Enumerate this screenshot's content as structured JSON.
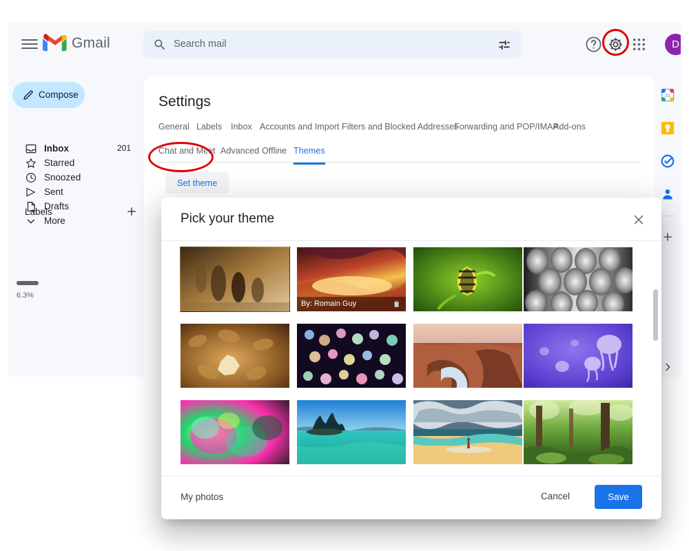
{
  "app": {
    "name": "Gmail",
    "logo_icon": "gmail-logo-icon",
    "menu_icon": "hamburger-menu-icon"
  },
  "search": {
    "placeholder": "Search mail",
    "value": "",
    "search_icon": "search-icon",
    "filter_icon": "search-options-filter-icon"
  },
  "topbar_icons": {
    "help": "help-circle-icon",
    "settings": "gear-icon",
    "apps": "google-apps-grid-icon",
    "avatar_letter": "D",
    "avatar_color": "#8e24aa"
  },
  "sidebar": {
    "compose_label": "Compose",
    "compose_icon": "pencil-icon",
    "compose_bg": "#c2e7ff",
    "items": [
      {
        "label": "Inbox",
        "icon": "inbox-icon",
        "count": "201",
        "active": true
      },
      {
        "label": "Starred",
        "icon": "star-icon",
        "count": "",
        "active": false
      },
      {
        "label": "Snoozed",
        "icon": "clock-icon",
        "count": "",
        "active": false
      },
      {
        "label": "Sent",
        "icon": "send-icon",
        "count": "",
        "active": false
      },
      {
        "label": "Drafts",
        "icon": "document-icon",
        "count": "",
        "active": false
      },
      {
        "label": "More",
        "icon": "chevron-down-icon",
        "count": "",
        "active": false
      }
    ],
    "labels_header": "Labels",
    "labels_add_icon": "plus-icon",
    "storage_text": "6.3%"
  },
  "settings": {
    "title": "Settings",
    "tabs_row1": [
      {
        "label": "General",
        "selected": false
      },
      {
        "label": "Labels",
        "selected": false
      },
      {
        "label": "Inbox",
        "selected": false
      },
      {
        "label": "Accounts and Import",
        "selected": false
      },
      {
        "label": "Filters and Blocked Addresses",
        "selected": false
      },
      {
        "label": "Forwarding and POP/IMAP",
        "selected": false
      },
      {
        "label": "Add-ons",
        "selected": false
      }
    ],
    "tabs_row2": [
      {
        "label": "Chat and Meet",
        "selected": false
      },
      {
        "label": "Advanced",
        "selected": false
      },
      {
        "label": "Offline",
        "selected": false
      },
      {
        "label": "Themes",
        "selected": true
      }
    ],
    "set_theme_label": "Set theme",
    "accent_color": "#1a73e8"
  },
  "right_rail": {
    "items": [
      {
        "name": "google-calendar-icon",
        "label": "31"
      },
      {
        "name": "google-keep-icon",
        "label": ""
      },
      {
        "name": "google-tasks-icon",
        "label": ""
      },
      {
        "name": "google-contacts-icon",
        "label": ""
      }
    ],
    "add_icon": "plus-icon",
    "expand_icon": "chevron-right-icon"
  },
  "dialog": {
    "title": "Pick your theme",
    "close_icon": "close-icon",
    "my_photos_label": "My photos",
    "cancel_label": "Cancel",
    "save_label": "Save",
    "save_color": "#1a73e8",
    "themes": [
      {
        "name": "chess-board-theme",
        "attribution": "",
        "c1": "#cfa86b",
        "c2": "#6b4b24",
        "c3": "#2b1d0e"
      },
      {
        "name": "slot-canyon-theme",
        "attribution": "By: Romain Guy",
        "c1": "#f6c24a",
        "c2": "#c0452a",
        "c3": "#3c0f10"
      },
      {
        "name": "caterpillar-theme",
        "attribution": "",
        "c1": "#8fd12a",
        "c2": "#2f7a12",
        "c3": "#0e3b06"
      },
      {
        "name": "metal-pipes-theme",
        "attribution": "",
        "c1": "#e6e6e6",
        "c2": "#8a8a8a",
        "c3": "#1d1d1d"
      },
      {
        "name": "autumn-leaves-theme",
        "attribution": "",
        "c1": "#e0a85a",
        "c2": "#8a5a24",
        "c3": "#3a1f0d"
      },
      {
        "name": "bokeh-lights-theme",
        "attribution": "",
        "c1": "#f2a0c8",
        "c2": "#7fd6c0",
        "c3": "#120a20"
      },
      {
        "name": "canyon-river-theme",
        "attribution": "",
        "c1": "#e3b59a",
        "c2": "#a6543a",
        "c3": "#4a2014"
      },
      {
        "name": "jellyfish-theme",
        "attribution": "",
        "c1": "#c3b6f2",
        "c2": "#6f4fd8",
        "c3": "#2d1c8c"
      },
      {
        "name": "oil-slick-theme",
        "attribution": "",
        "c1": "#ff2fb0",
        "c2": "#22d66a",
        "c3": "#0b1a12"
      },
      {
        "name": "lake-tahoe-theme",
        "attribution": "",
        "c1": "#1f8fd6",
        "c2": "#2fd1c0",
        "c3": "#0d4a6b"
      },
      {
        "name": "stormy-beach-theme",
        "attribution": "",
        "c1": "#f0c97a",
        "c2": "#3f5f78",
        "c3": "#1d2b38"
      },
      {
        "name": "green-forest-theme",
        "attribution": "",
        "c1": "#a8d85a",
        "c2": "#3f7a2a",
        "c3": "#1b3a12"
      }
    ],
    "attribution_trash_icon": "trash-icon"
  },
  "annotations": [
    {
      "name": "gear-icon-highlight",
      "color": "#e00000",
      "shape": "ellipse"
    },
    {
      "name": "set-theme-button-highlight",
      "color": "#e00000",
      "shape": "ellipse"
    }
  ]
}
